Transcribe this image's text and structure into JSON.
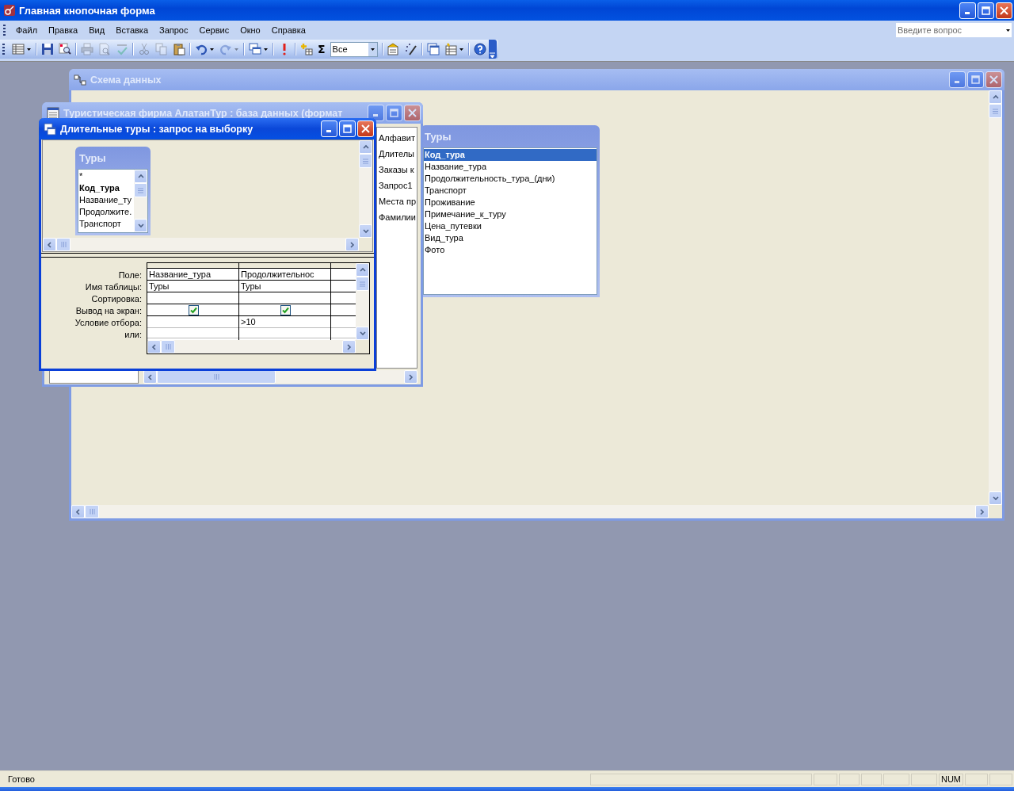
{
  "window": {
    "title": "Главная кнопочная форма"
  },
  "menu": [
    {
      "label": "Файл"
    },
    {
      "label": "Правка"
    },
    {
      "label": "Вид"
    },
    {
      "label": "Вставка"
    },
    {
      "label": "Запрос"
    },
    {
      "label": "Сервис"
    },
    {
      "label": "Окно"
    },
    {
      "label": "Справка"
    }
  ],
  "help_box": {
    "placeholder": "Введите вопрос"
  },
  "toolbar": [
    {
      "kind": "view",
      "disabled": false,
      "dropdown": true
    },
    {
      "kind": "separator"
    },
    {
      "kind": "save",
      "disabled": false
    },
    {
      "kind": "search",
      "disabled": false
    },
    {
      "kind": "separator"
    },
    {
      "kind": "print",
      "disabled": true
    },
    {
      "kind": "preview",
      "disabled": true
    },
    {
      "kind": "spell",
      "disabled": true
    },
    {
      "kind": "separator"
    },
    {
      "kind": "cut",
      "disabled": true
    },
    {
      "kind": "copy",
      "disabled": true
    },
    {
      "kind": "paste",
      "disabled": false
    },
    {
      "kind": "separator"
    },
    {
      "kind": "undo",
      "disabled": false,
      "dropdown": true
    },
    {
      "kind": "redo",
      "disabled": true,
      "dropdown": true
    },
    {
      "kind": "separator"
    },
    {
      "kind": "query_type",
      "disabled": false,
      "dropdown": true
    },
    {
      "kind": "separator"
    },
    {
      "kind": "run",
      "disabled": false
    },
    {
      "kind": "separator"
    },
    {
      "kind": "show_table",
      "disabled": false
    },
    {
      "kind": "totals",
      "label": "Σ",
      "disabled": false
    },
    {
      "kind": "combo",
      "value": "Все"
    },
    {
      "kind": "separator"
    },
    {
      "kind": "properties",
      "disabled": false
    },
    {
      "kind": "build",
      "disabled": false
    },
    {
      "kind": "separator"
    },
    {
      "kind": "database_window",
      "disabled": false
    },
    {
      "kind": "new_object",
      "disabled": false,
      "dropdown": true
    },
    {
      "kind": "separator"
    },
    {
      "kind": "help",
      "disabled": false
    }
  ],
  "relationship_window": {
    "title": "Схема данных",
    "active": false,
    "table": {
      "title": "Туры",
      "fields": [
        {
          "label": "Код_тура",
          "selected": true
        },
        {
          "label": "Название_тура",
          "selected": false
        },
        {
          "label": "Продолжительность_тура_(дни)",
          "selected": false
        },
        {
          "label": "Транспорт",
          "selected": false
        },
        {
          "label": "Проживание",
          "selected": false
        },
        {
          "label": "Примечание_к_туру",
          "selected": false
        },
        {
          "label": "Цена_путевки",
          "selected": false
        },
        {
          "label": "Вид_тура",
          "selected": false
        },
        {
          "label": "Фото",
          "selected": false
        }
      ]
    }
  },
  "database_window": {
    "title": "Туристическая фирма АлатанТур : база данных (формат",
    "active": false,
    "objects": [
      {
        "label": "Алфавит"
      },
      {
        "label": "Длителы"
      },
      {
        "label": "Заказы к"
      },
      {
        "label": "Запрос1"
      },
      {
        "label": "Места пр"
      },
      {
        "label": "Фамилии"
      }
    ]
  },
  "query_window": {
    "title": "Длительные туры : запрос на выборку",
    "active": true,
    "table": {
      "title": "Туры",
      "fields": [
        {
          "label": "*",
          "bold": false
        },
        {
          "label": "Код_тура",
          "bold": true
        },
        {
          "label": "Название_ту",
          "bold": false
        },
        {
          "label": "Продолжите.",
          "bold": false
        },
        {
          "label": "Транспорт",
          "bold": false
        }
      ]
    },
    "row_labels": [
      "Поле:",
      "Имя таблицы:",
      "Сортировка:",
      "Вывод на экран:",
      "Условие отбора:",
      "или:"
    ],
    "columns": [
      {
        "field": "Название_тура",
        "table": "Туры",
        "show": true
      },
      {
        "field": "Продолжительнос",
        "table": "Туры",
        "show": true,
        "criteria": ">10"
      }
    ]
  },
  "status_bar": {
    "text": "Готово",
    "indicators": [
      {
        "label": "NUM"
      }
    ]
  }
}
